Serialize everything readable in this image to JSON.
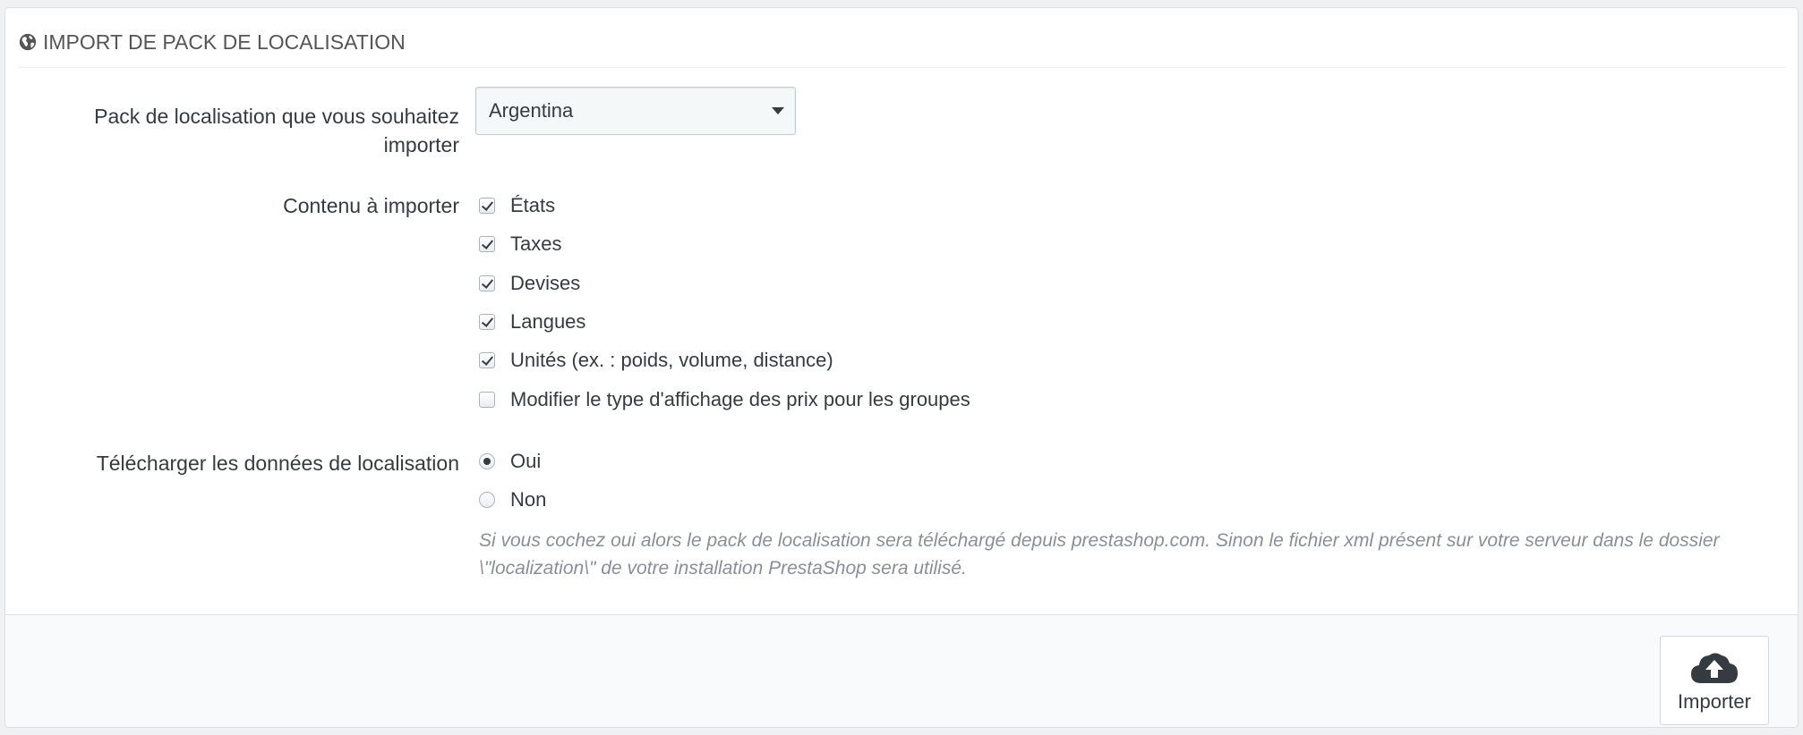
{
  "panel": {
    "title": "IMPORT DE PACK DE LOCALISATION",
    "title_icon": "globe-icon"
  },
  "form": {
    "pack_label": "Pack de localisation que vous souhaitez importer",
    "pack_value": "Argentina",
    "content_label": "Contenu à importer",
    "content_options": [
      {
        "label": "États",
        "checked": true
      },
      {
        "label": "Taxes",
        "checked": true
      },
      {
        "label": "Devises",
        "checked": true
      },
      {
        "label": "Langues",
        "checked": true
      },
      {
        "label": "Unités (ex. : poids, volume, distance)",
        "checked": true
      },
      {
        "label": "Modifier le type d'affichage des prix pour les groupes",
        "checked": false
      }
    ],
    "download_label": "Télécharger les données de localisation",
    "download_options": [
      {
        "label": "Oui",
        "selected": true
      },
      {
        "label": "Non",
        "selected": false
      }
    ],
    "help_text": "Si vous cochez oui alors le pack de localisation sera téléchargé depuis prestashop.com. Sinon le fichier xml présent sur votre serveur dans le dossier \\\"localization\\\" de votre installation PrestaShop sera utilisé."
  },
  "footer": {
    "import_button": "Importer",
    "import_icon": "cloud-upload-icon"
  }
}
